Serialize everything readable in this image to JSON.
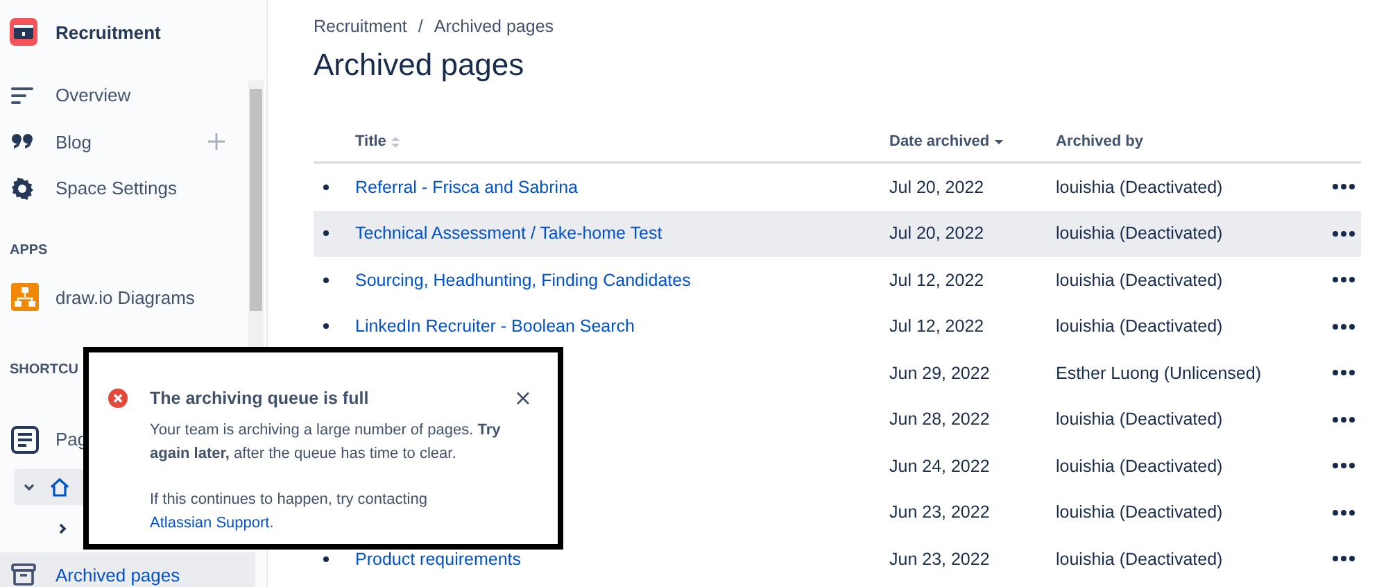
{
  "sidebar": {
    "space_name": "Recruitment",
    "items": [
      {
        "kind": "overview",
        "label": "Overview"
      },
      {
        "kind": "blog",
        "label": "Blog"
      },
      {
        "kind": "settings",
        "label": "Space Settings"
      }
    ],
    "apps_heading": "APPS",
    "apps": [
      {
        "label": "draw.io Diagrams"
      }
    ],
    "shortcuts_heading": "SHORTCU",
    "pages_label": "Pag",
    "tree": [
      {
        "expanded": true
      },
      {
        "expanded": false
      }
    ],
    "archived": {
      "label": "Archived pages",
      "selected": true
    }
  },
  "breadcrumbs": [
    "Recruitment",
    "Archived pages"
  ],
  "breadcrumb_separator": "/",
  "title": "Archived pages",
  "table": {
    "columns": [
      "Title",
      "Date archived",
      "Archived by"
    ],
    "rows": [
      {
        "title": "Referral - Frisca and Sabrina",
        "date": "Jul 20, 2022",
        "by": "louishia (Deactivated)",
        "hovered": false
      },
      {
        "title": "Technical Assessment / Take-home Test",
        "date": "Jul 20, 2022",
        "by": "louishia (Deactivated)",
        "hovered": true
      },
      {
        "title": "Sourcing, Headhunting, Finding Candidates",
        "date": "Jul 12, 2022",
        "by": "louishia (Deactivated)",
        "hovered": false
      },
      {
        "title": "LinkedIn Recruiter - Boolean Search",
        "date": "Jul 12, 2022",
        "by": "louishia (Deactivated)",
        "hovered": false
      },
      {
        "date": "Jun 29, 2022",
        "by": "Esther Luong (Unlicensed)",
        "hovered": false
      },
      {
        "date": "Jun 28, 2022",
        "by": "louishia (Deactivated)",
        "hovered": false
      },
      {
        "date": "Jun 24, 2022",
        "by": "louishia (Deactivated)",
        "hovered": false
      },
      {
        "date": "Jun 23, 2022",
        "by": "louishia (Deactivated)",
        "hovered": false
      },
      {
        "title": "Product requirements",
        "date": "Jun 23, 2022",
        "by": "louishia (Deactivated)",
        "hovered": false
      }
    ]
  },
  "flag": {
    "title": "The archiving queue is full",
    "body": "Your team is archiving a large number of pages. **Try again later,** after the queue has time to clear.",
    "help_text": "If this continues to happen, try contacting",
    "help_link": "Atlassian Support",
    "help_end": "."
  }
}
